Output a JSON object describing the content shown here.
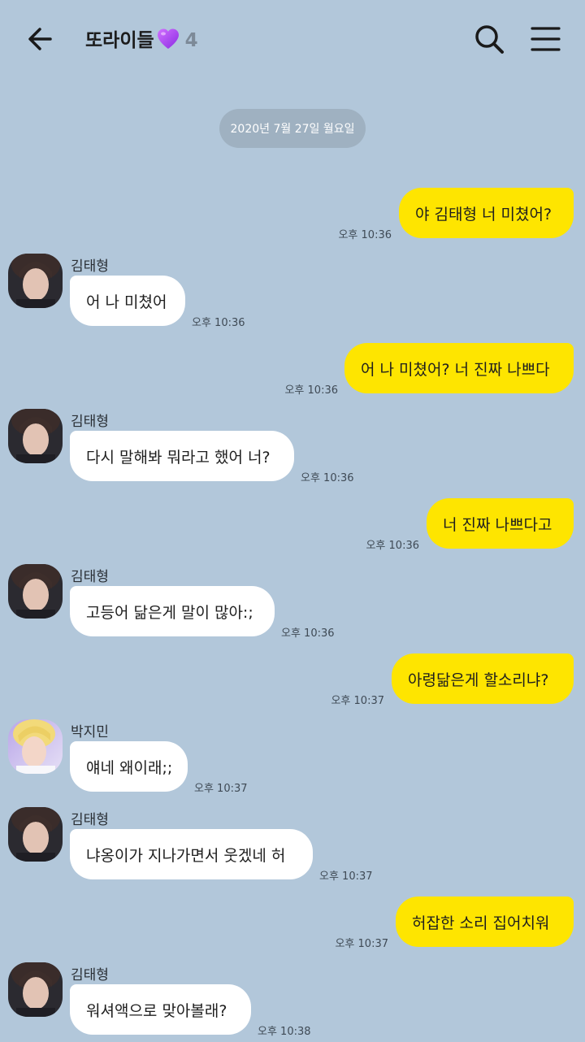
{
  "header": {
    "title": "또라이들",
    "member_count": "4",
    "back_icon": "arrow-left-icon",
    "search_icon": "search-icon",
    "menu_icon": "hamburger-menu-icon"
  },
  "date_divider": "2020년 7월 27일 월요일",
  "messages": [
    {
      "side": "me",
      "text": "야 김태형 너 미쳤어?",
      "time": "오후 10:36"
    },
    {
      "side": "other",
      "sender": "김태형",
      "text": "어 나 미쳤어",
      "time": "오후 10:36"
    },
    {
      "side": "me",
      "text": "어 나 미쳤어? 너 진짜 나쁘다",
      "time": "오후 10:36"
    },
    {
      "side": "other",
      "sender": "김태형",
      "text": "다시 말해봐 뭐라고 했어 너?",
      "time": "오후 10:36"
    },
    {
      "side": "me",
      "text": "너 진짜 나쁘다고",
      "time": "오후 10:36"
    },
    {
      "side": "other",
      "sender": "김태형",
      "text": "고등어 닮은게 말이 많아:;",
      "time": "오후 10:36"
    },
    {
      "side": "me",
      "text": "아령닮은게 할소리냐?",
      "time": "오후 10:37"
    },
    {
      "side": "other",
      "sender": "박지민",
      "text": "얘네 왜이래;;",
      "time": "오후 10:37"
    },
    {
      "side": "other",
      "sender": "김태형",
      "text": "냐옹이가 지나가면서 웃겠네 허",
      "time": "오후 10:37"
    },
    {
      "side": "me",
      "text": "허잡한 소리 집어치워",
      "time": "오후 10:37"
    },
    {
      "side": "other",
      "sender": "김태형",
      "text": "워셔액으로 맞아볼래?",
      "time": "오후 10:38"
    }
  ],
  "colors": {
    "background": "#b2c7da",
    "my_bubble": "#fee500",
    "other_bubble": "#ffffff",
    "date_pill": "#9fb1c1"
  }
}
